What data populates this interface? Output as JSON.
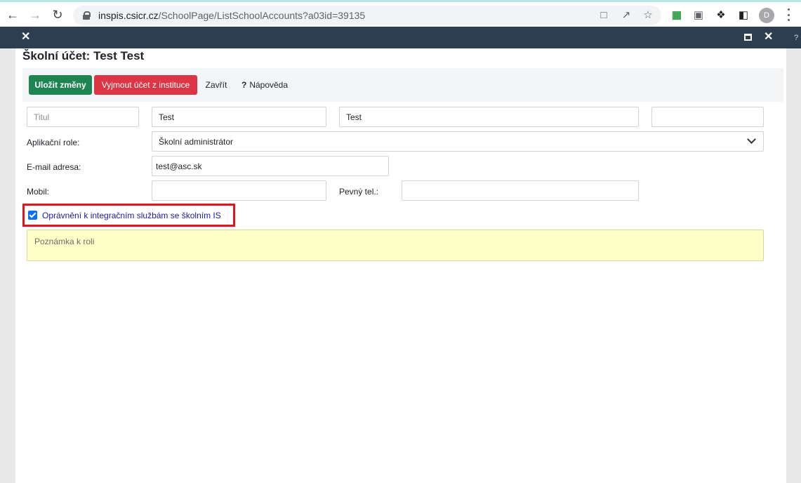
{
  "browser": {
    "url_host": "inspis.csicr.cz",
    "url_path": "/SchoolPage/ListSchoolAccounts?a03id=39135",
    "profile_initial": "D"
  },
  "page": {
    "help_glyph": "?"
  },
  "dialog": {
    "title": "Školní účet: Test Test",
    "toolbar": {
      "save_label": "Uložit změny",
      "remove_label": "Vyjmout účet z instituce",
      "close_label": "Zavřít",
      "help_icon": "?",
      "help_label": "Nápověda"
    },
    "form": {
      "title_placeholder": "Titul",
      "first_name": "Test",
      "last_name": "Test",
      "suffix_value": "",
      "role_label": "Aplikační role:",
      "role_value": "Školní administrátor",
      "email_label": "E-mail adresa:",
      "email_value": "test@asc.sk",
      "mobile_label": "Mobil:",
      "mobile_value": "",
      "phone_label": "Pevný tel.:",
      "phone_value": "",
      "integration_checkbox_label": "Oprávnění k integračním službám se školním IS",
      "integration_checked": true,
      "note_placeholder": "Poznámka k roli"
    }
  },
  "colors": {
    "save": "#1c8552",
    "remove": "#dc3545",
    "titlebar": "#2c3e50",
    "highlight": "#e0161e",
    "note_bg": "#ffffc8"
  }
}
